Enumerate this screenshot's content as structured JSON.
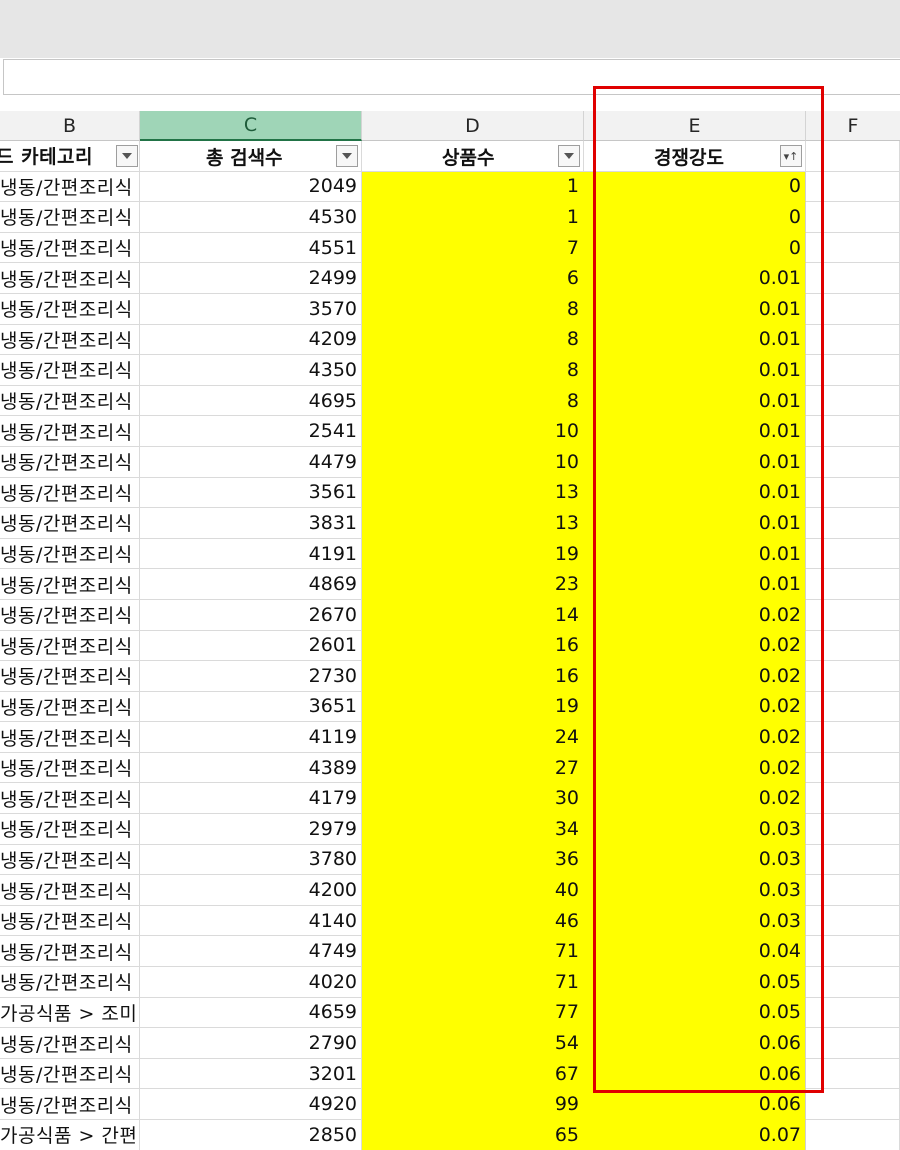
{
  "columns": {
    "b": "B",
    "c": "C",
    "d": "D",
    "e": "E",
    "f": "F"
  },
  "headers": {
    "b": "드 카테고리",
    "c": "총 검색수",
    "d": "상품수",
    "e": "경쟁강도",
    "e_sort_icon": "sort-descending-filter-icon"
  },
  "rows": [
    {
      "b": "냉동/간편조리식",
      "c": "2049",
      "d": "1",
      "e": "0"
    },
    {
      "b": "냉동/간편조리식",
      "c": "4530",
      "d": "1",
      "e": "0"
    },
    {
      "b": "냉동/간편조리식",
      "c": "4551",
      "d": "7",
      "e": "0"
    },
    {
      "b": "냉동/간편조리식",
      "c": "2499",
      "d": "6",
      "e": "0.01"
    },
    {
      "b": "냉동/간편조리식",
      "c": "3570",
      "d": "8",
      "e": "0.01"
    },
    {
      "b": "냉동/간편조리식",
      "c": "4209",
      "d": "8",
      "e": "0.01"
    },
    {
      "b": "냉동/간편조리식",
      "c": "4350",
      "d": "8",
      "e": "0.01"
    },
    {
      "b": "냉동/간편조리식",
      "c": "4695",
      "d": "8",
      "e": "0.01"
    },
    {
      "b": "냉동/간편조리식",
      "c": "2541",
      "d": "10",
      "e": "0.01"
    },
    {
      "b": "냉동/간편조리식",
      "c": "4479",
      "d": "10",
      "e": "0.01"
    },
    {
      "b": "냉동/간편조리식",
      "c": "3561",
      "d": "13",
      "e": "0.01"
    },
    {
      "b": "냉동/간편조리식",
      "c": "3831",
      "d": "13",
      "e": "0.01"
    },
    {
      "b": "냉동/간편조리식",
      "c": "4191",
      "d": "19",
      "e": "0.01"
    },
    {
      "b": "냉동/간편조리식",
      "c": "4869",
      "d": "23",
      "e": "0.01"
    },
    {
      "b": "냉동/간편조리식",
      "c": "2670",
      "d": "14",
      "e": "0.02"
    },
    {
      "b": "냉동/간편조리식",
      "c": "2601",
      "d": "16",
      "e": "0.02"
    },
    {
      "b": "냉동/간편조리식",
      "c": "2730",
      "d": "16",
      "e": "0.02"
    },
    {
      "b": "냉동/간편조리식",
      "c": "3651",
      "d": "19",
      "e": "0.02"
    },
    {
      "b": "냉동/간편조리식",
      "c": "4119",
      "d": "24",
      "e": "0.02"
    },
    {
      "b": "냉동/간편조리식",
      "c": "4389",
      "d": "27",
      "e": "0.02"
    },
    {
      "b": "냉동/간편조리식",
      "c": "4179",
      "d": "30",
      "e": "0.02"
    },
    {
      "b": "냉동/간편조리식",
      "c": "2979",
      "d": "34",
      "e": "0.03"
    },
    {
      "b": "냉동/간편조리식",
      "c": "3780",
      "d": "36",
      "e": "0.03"
    },
    {
      "b": "냉동/간편조리식",
      "c": "4200",
      "d": "40",
      "e": "0.03"
    },
    {
      "b": "냉동/간편조리식",
      "c": "4140",
      "d": "46",
      "e": "0.03"
    },
    {
      "b": "냉동/간편조리식",
      "c": "4749",
      "d": "71",
      "e": "0.04"
    },
    {
      "b": "냉동/간편조리식",
      "c": "4020",
      "d": "71",
      "e": "0.05"
    },
    {
      "b": "가공식품 > 조미",
      "c": "4659",
      "d": "77",
      "e": "0.05"
    },
    {
      "b": "냉동/간편조리식",
      "c": "2790",
      "d": "54",
      "e": "0.06"
    },
    {
      "b": "냉동/간편조리식",
      "c": "3201",
      "d": "67",
      "e": "0.06"
    },
    {
      "b": "냉동/간편조리식",
      "c": "4920",
      "d": "99",
      "e": "0.06"
    },
    {
      "b": "가공식품 > 간편",
      "c": "2850",
      "d": "65",
      "e": "0.07"
    }
  ],
  "colors": {
    "highlight_fill": "#ffff00",
    "annotation_box": "#e00000",
    "selected_column_header": "#9fd5b7"
  }
}
